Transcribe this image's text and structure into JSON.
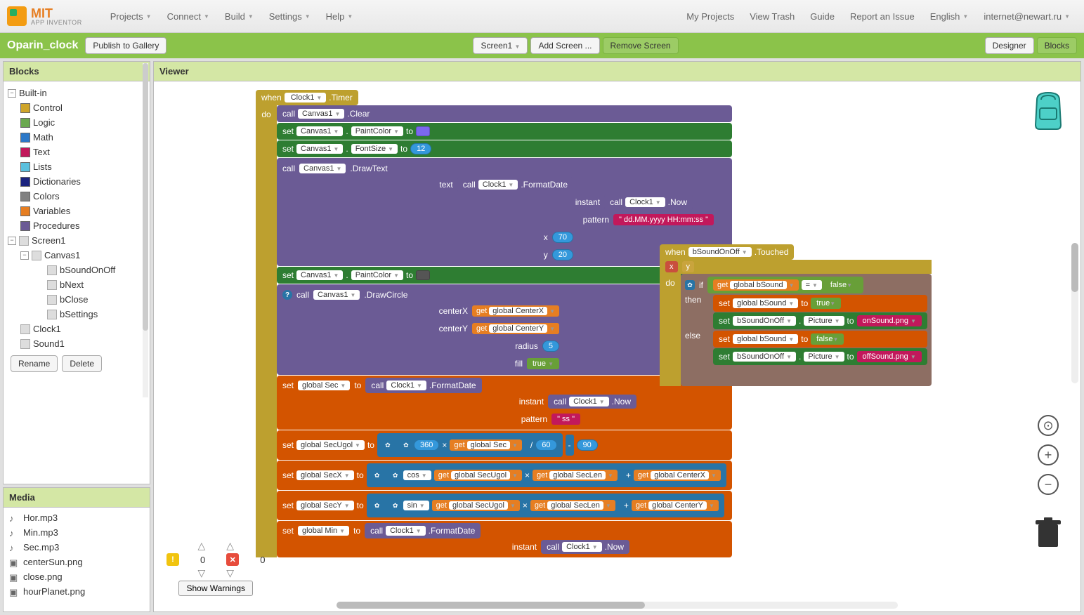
{
  "logo": {
    "title": "MIT",
    "subtitle": "APP INVENTOR"
  },
  "topMenu": {
    "left": [
      "Projects",
      "Connect",
      "Build",
      "Settings",
      "Help"
    ],
    "right": [
      "My Projects",
      "View Trash",
      "Guide",
      "Report an Issue",
      "English",
      "internet@newart.ru"
    ]
  },
  "projectBar": {
    "name": "Oparin_clock",
    "publish": "Publish to Gallery",
    "screenDropdown": "Screen1",
    "addScreen": "Add Screen ...",
    "removeScreen": "Remove Screen",
    "designer": "Designer",
    "blocks": "Blocks"
  },
  "sidebar": {
    "blocksHeader": "Blocks",
    "builtin": "Built-in",
    "categories": [
      {
        "name": "Control",
        "color": "#cfa52a"
      },
      {
        "name": "Logic",
        "color": "#6aa84f"
      },
      {
        "name": "Math",
        "color": "#2b78c8"
      },
      {
        "name": "Text",
        "color": "#c2185b"
      },
      {
        "name": "Lists",
        "color": "#5bc0de"
      },
      {
        "name": "Dictionaries",
        "color": "#1a237e"
      },
      {
        "name": "Colors",
        "color": "#808080"
      },
      {
        "name": "Variables",
        "color": "#e67e22"
      },
      {
        "name": "Procedures",
        "color": "#6b5b95"
      }
    ],
    "tree": {
      "screen": "Screen1",
      "canvas": "Canvas1",
      "canvasChildren": [
        "bSoundOnOff",
        "bNext",
        "bClose",
        "bSettings"
      ],
      "rest": [
        "Clock1",
        "Sound1"
      ]
    },
    "rename": "Rename",
    "delete": "Delete",
    "mediaHeader": "Media",
    "media": [
      "Hor.mp3",
      "Min.mp3",
      "Sec.mp3",
      "centerSun.png",
      "close.png",
      "hourPlanet.png"
    ]
  },
  "viewer": {
    "header": "Viewer",
    "warnings": {
      "yellow": "0",
      "red": "0",
      "showBtn": "Show Warnings"
    }
  },
  "blocks": {
    "event1": {
      "when": "when",
      "comp": "Clock1",
      "evt": ".Timer",
      "do": "do"
    },
    "s1": {
      "call": "call",
      "comp": "Canvas1",
      "method": ".Clear"
    },
    "s2": {
      "set": "set",
      "comp": "Canvas1",
      "prop": "PaintColor",
      "to": "to",
      "color": "#7b68ee"
    },
    "s3": {
      "set": "set",
      "comp": "Canvas1",
      "prop": "FontSize",
      "to": "to",
      "val": "12"
    },
    "s4": {
      "call": "call",
      "comp": "Canvas1",
      "method": ".DrawText",
      "args": {
        "text": "text",
        "x": "x",
        "y": "y",
        "fd": {
          "call": "call",
          "comp": "Clock1",
          "method": ".FormatDate"
        },
        "instant": "instant",
        "now": {
          "call": "call",
          "comp": "Clock1",
          "method": ".Now"
        },
        "pattern": "pattern",
        "patVal": "dd.MM.yyyy   HH:mm:ss",
        "xVal": "70",
        "yVal": "20"
      }
    },
    "s5": {
      "set": "set",
      "comp": "Canvas1",
      "prop": "PaintColor",
      "to": "to",
      "color": "#555555"
    },
    "s6": {
      "call": "call",
      "comp": "Canvas1",
      "method": ".DrawCircle",
      "cx": "centerX",
      "cxVal": "global CenterX",
      "cy": "centerY",
      "cyVal": "global CenterY",
      "radius": "radius",
      "rVal": "5",
      "fill": "fill",
      "fillVal": "true"
    },
    "s7": {
      "set": "set",
      "var": "global Sec",
      "to": "to",
      "fd": {
        "call": "call",
        "comp": "Clock1",
        "method": ".FormatDate"
      },
      "instant": "instant",
      "now": {
        "call": "call",
        "comp": "Clock1",
        "method": ".Now"
      },
      "pattern": "pattern",
      "patVal": "ss"
    },
    "s8": {
      "set": "set",
      "var": "global SecUgol",
      "to": "to",
      "n360": "360",
      "times": "×",
      "get": "get",
      "gSec": "global Sec",
      "div": "/",
      "n60": "60",
      "minus": "-",
      "n90": "90"
    },
    "s9": {
      "set": "set",
      "var": "global SecX",
      "to": "to",
      "fn": "cos",
      "get": "get",
      "gSecUgol": "global SecUgol",
      "times": "×",
      "gSecLen": "global SecLen",
      "plus": "+",
      "gCenterX": "global CenterX"
    },
    "s10": {
      "set": "set",
      "var": "global SecY",
      "to": "to",
      "fn": "sin",
      "get": "get",
      "gSecUgol": "global SecUgol",
      "times": "×",
      "gSecLen": "global SecLen",
      "plus": "+",
      "gCenterY": "global CenterY"
    },
    "s11": {
      "set": "set",
      "var": "global Min",
      "to": "to",
      "fd": {
        "call": "call",
        "comp": "Clock1",
        "method": ".FormatDate"
      },
      "instant": "instant",
      "now": {
        "call": "call",
        "comp": "Clock1",
        "method": ".Now"
      }
    },
    "event2": {
      "when": "when",
      "comp": "bSoundOnOff",
      "evt": ".Touched",
      "x": "x",
      "y": "y",
      "do": "do",
      "if": "if",
      "then": "then",
      "else": "else",
      "get": "get",
      "gbSound": "global bSound",
      "eq": "=",
      "false": "false",
      "set": "set",
      "to": "to",
      "true": "true",
      "prop": "Picture",
      "onPng": "onSound.png",
      "offPng": "offSound.png"
    }
  }
}
